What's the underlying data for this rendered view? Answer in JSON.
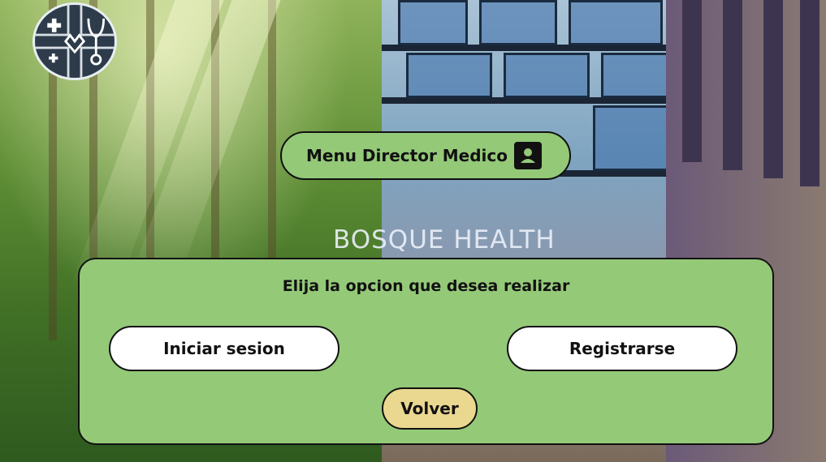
{
  "header": {
    "title": "Menu Director Medico",
    "icon": "user-icon"
  },
  "background_sign": "BOSQUE HEALTH",
  "panel": {
    "prompt": "Elija la opcion que desea realizar",
    "login_label": "Iniciar sesion",
    "register_label": "Registrarse",
    "back_label": "Volver"
  },
  "colors": {
    "panel_green": "#94c978",
    "back_button": "#ead790",
    "button_white": "#ffffff",
    "border": "#111111"
  }
}
